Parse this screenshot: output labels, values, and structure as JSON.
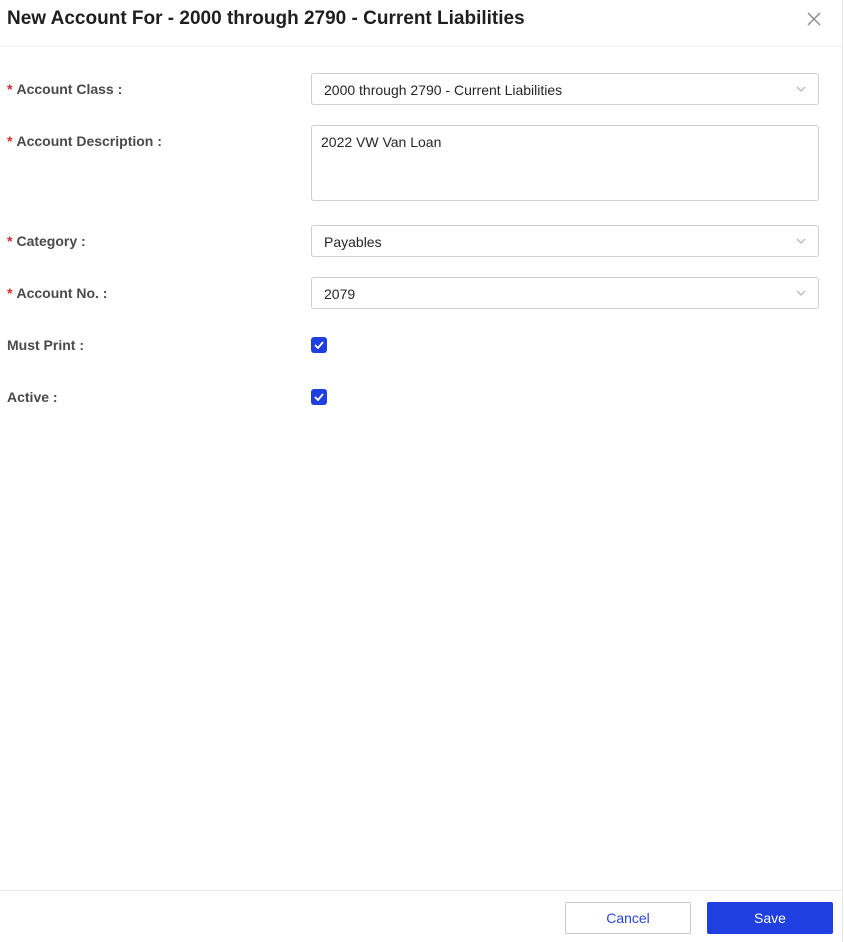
{
  "dialog": {
    "title": "New Account For - 2000 through 2790 - Current Liabilities"
  },
  "form": {
    "required_mark": "*",
    "account_class": {
      "label": "Account Class :",
      "value": "2000 through 2790 - Current Liabilities",
      "required": true
    },
    "account_description": {
      "label": "Account Description :",
      "value": "2022 VW Van Loan",
      "required": true
    },
    "category": {
      "label": "Category :",
      "value": "Payables",
      "required": true
    },
    "account_no": {
      "label": "Account No. :",
      "value": "2079",
      "required": true
    },
    "must_print": {
      "label": "Must Print :",
      "checked": true
    },
    "active": {
      "label": "Active :",
      "checked": true
    }
  },
  "footer": {
    "cancel_label": "Cancel",
    "save_label": "Save"
  },
  "colors": {
    "accent": "#1f3fe0",
    "required": "#e0282e",
    "border": "#cfcfcf"
  },
  "icons": {
    "close": "close-icon",
    "chevron": "chevron-down-icon",
    "check": "check-icon"
  }
}
